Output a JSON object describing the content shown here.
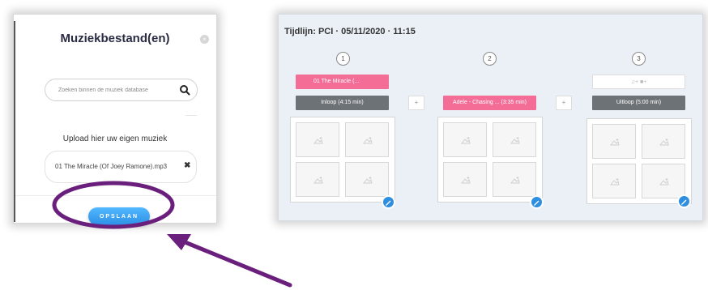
{
  "modal": {
    "title": "Muziekbestand(en)",
    "close_label": "×",
    "search": {
      "placeholder": "Zoeken binnen de muziek database",
      "icon": "search-icon"
    },
    "upload_label": "Upload hier uw eigen muziek",
    "file": {
      "name": "01 The Miracle (Of Joey Ramone).mp3",
      "remove_label": "✖"
    },
    "save_label": "OPSLAAN"
  },
  "timeline": {
    "title": "Tijdlijn: PCI · 05/11/2020 · 11:15",
    "columns": [
      {
        "number": "1",
        "music_chip": "01 The Miracle (...",
        "segment": "Inloop (4:15 min)"
      },
      {
        "number": "2",
        "segment": "Adele - Chasing ... (3:35 min)"
      },
      {
        "number": "3",
        "media_chip": "♫+  ■+",
        "segment": "Uitloop (5:00 min)"
      }
    ],
    "plus_label": "+"
  },
  "colors": {
    "accent_blue": "#2e8ee0",
    "pink": "#f36d97",
    "gray_segment": "#6d7277",
    "annotation_purple": "#6b1f7d"
  }
}
